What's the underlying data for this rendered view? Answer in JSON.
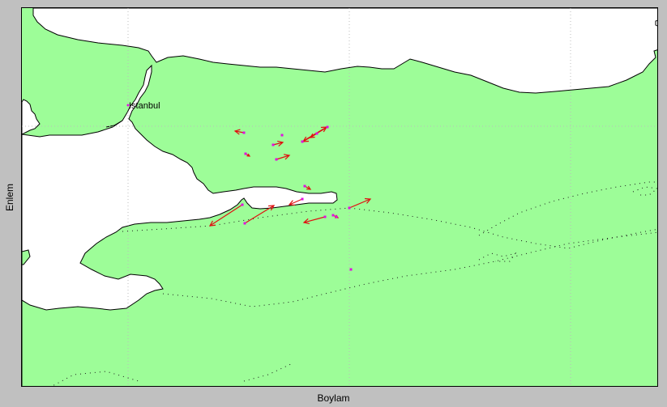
{
  "map": {
    "xlabel": "Boylam",
    "ylabel": "Enlem",
    "city_label": "Istanbul",
    "colors": {
      "land": "#9dfd98",
      "sea": "#ffffff",
      "coast": "#000000",
      "grid": "#bcbcbc",
      "vector": "#e01010",
      "station": "#e010e0",
      "track": "#1a1a1a",
      "frame_bg": "#c0c0c0"
    },
    "station_count": 17,
    "vector_count": 17
  }
}
